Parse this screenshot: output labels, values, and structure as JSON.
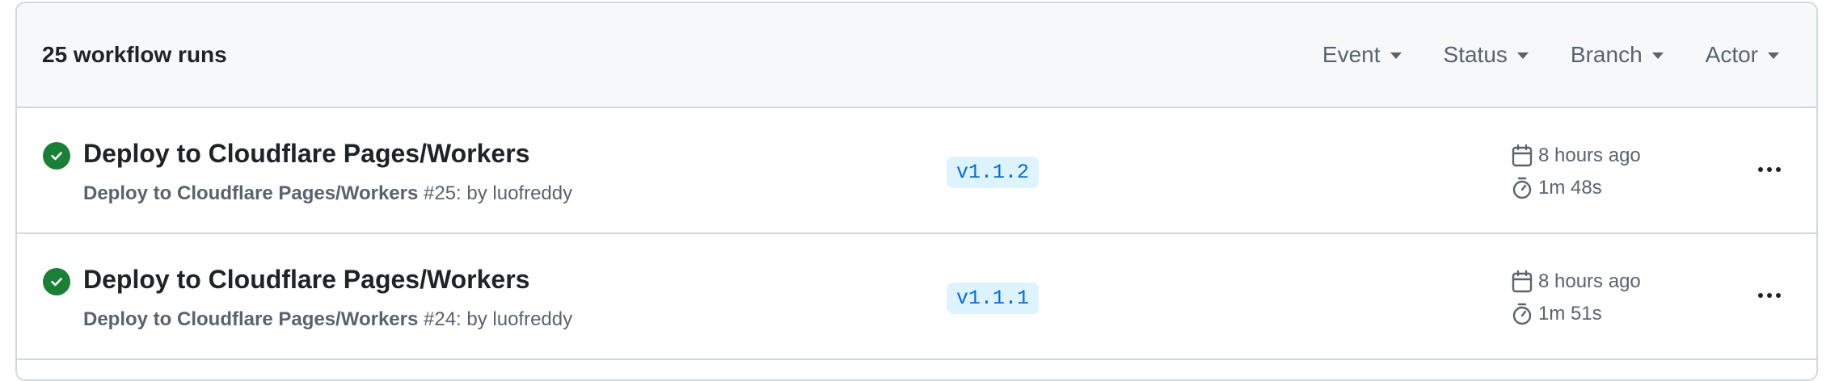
{
  "header": {
    "count_label": "25 workflow runs",
    "filters": [
      {
        "label": "Event"
      },
      {
        "label": "Status"
      },
      {
        "label": "Branch"
      },
      {
        "label": "Actor"
      }
    ]
  },
  "runs": [
    {
      "title": "Deploy to Cloudflare Pages/Workers",
      "workflow": "Deploy to Cloudflare Pages/Workers",
      "run_info": " #25: by luofreddy",
      "branch": "v1.1.2",
      "when": "8 hours ago",
      "duration": "1m 48s",
      "status_icon": "check-circle-icon"
    },
    {
      "title": "Deploy to Cloudflare Pages/Workers",
      "workflow": "Deploy to Cloudflare Pages/Workers",
      "run_info": " #24: by luofreddy",
      "branch": "v1.1.1",
      "when": "8 hours ago",
      "duration": "1m 51s",
      "status_icon": "check-circle-icon"
    }
  ],
  "colors": {
    "success": "#1a7f37",
    "header_bg": "#f6f8fa",
    "border": "#d1d9e0",
    "branch_bg": "#ddf4ff",
    "branch_fg": "#0969da"
  }
}
